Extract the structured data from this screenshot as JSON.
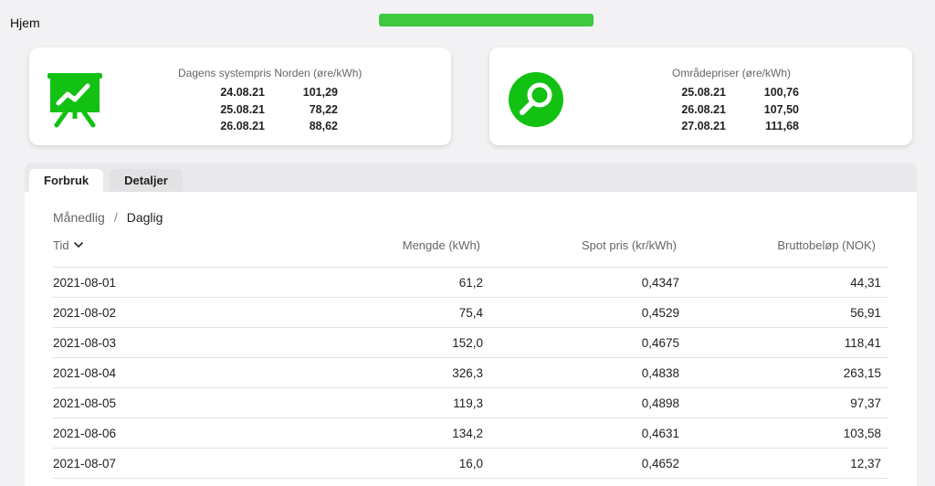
{
  "header": {
    "home_label": "Hjem"
  },
  "colors": {
    "accent": "#13c113",
    "redaction": "#3ec93e"
  },
  "system_price_card": {
    "icon": "presentation-chart-icon",
    "title": "Dagens systempris Norden (øre/kWh)",
    "rows": [
      {
        "date": "24.08.21",
        "value": "101,29"
      },
      {
        "date": "25.08.21",
        "value": "78,22"
      },
      {
        "date": "26.08.21",
        "value": "88,62"
      }
    ]
  },
  "area_price_card": {
    "icon": "magnifier-icon",
    "title": "Områdepriser (øre/kWh)",
    "rows": [
      {
        "date": "25.08.21",
        "value": "100,76"
      },
      {
        "date": "26.08.21",
        "value": "107,50"
      },
      {
        "date": "27.08.21",
        "value": "111,68"
      }
    ]
  },
  "tabs": [
    {
      "label": "Forbruk",
      "active": true
    },
    {
      "label": "Detaljer",
      "active": false
    }
  ],
  "breadcrumb": {
    "monthly": "Månedlig",
    "separator": "/",
    "daily": "Daglig"
  },
  "table": {
    "headers": {
      "tid": "Tid",
      "mengde": "Mengde (kWh)",
      "spot": "Spot pris (kr/kWh)",
      "brutto": "Bruttobeløp (NOK)"
    },
    "rows": [
      {
        "tid": "2021-08-01",
        "mengde": "61,2",
        "spot": "0,4347",
        "brutto": "44,31"
      },
      {
        "tid": "2021-08-02",
        "mengde": "75,4",
        "spot": "0,4529",
        "brutto": "56,91"
      },
      {
        "tid": "2021-08-03",
        "mengde": "152,0",
        "spot": "0,4675",
        "brutto": "118,41"
      },
      {
        "tid": "2021-08-04",
        "mengde": "326,3",
        "spot": "0,4838",
        "brutto": "263,15"
      },
      {
        "tid": "2021-08-05",
        "mengde": "119,3",
        "spot": "0,4898",
        "brutto": "97,37"
      },
      {
        "tid": "2021-08-06",
        "mengde": "134,2",
        "spot": "0,4631",
        "brutto": "103,58"
      },
      {
        "tid": "2021-08-07",
        "mengde": "16,0",
        "spot": "0,4652",
        "brutto": "12,37"
      }
    ]
  }
}
